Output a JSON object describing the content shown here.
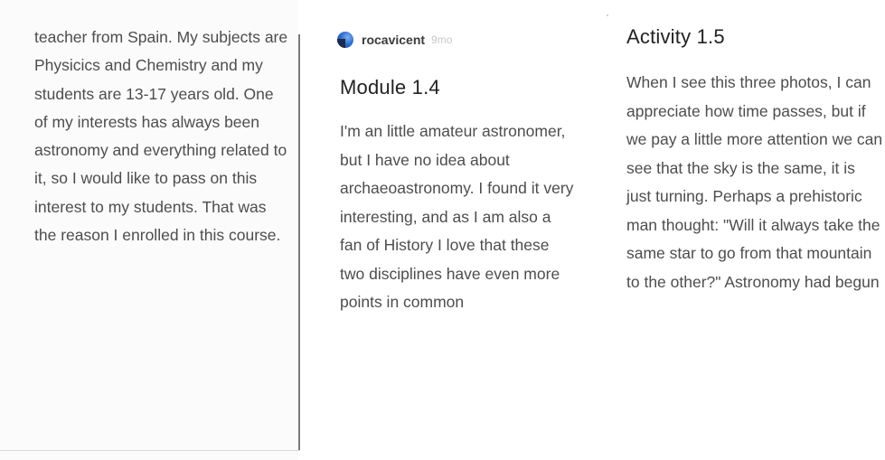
{
  "column1": {
    "body": "teacher from Spain. My subjects are Physicics and Chemistry and my students are 13-17 years old. One of my interests has always been astronomy and everything related to it, so I would like to pass on this interest to my students. That was the reason I enrolled in this course."
  },
  "column2": {
    "author": "rocavicent",
    "age": "9mo",
    "heading": "Module 1.4",
    "body": "I'm an little amateur astronomer, but I have no idea  about archaeoastronomy.  I found it very interesting, and as I am also a fan of History I love that these two disciplines have even more points in common"
  },
  "column3": {
    "heading": "Activity 1.5",
    "body": "When I see this three photos, I can appreciate how time passes, but if we pay a little more attention we can see that the sky is the same, it is just turning. Perhaps a prehistoric man thought: \"Will it always take the same star to go from that mountain to the other?\" Astronomy had begun"
  }
}
